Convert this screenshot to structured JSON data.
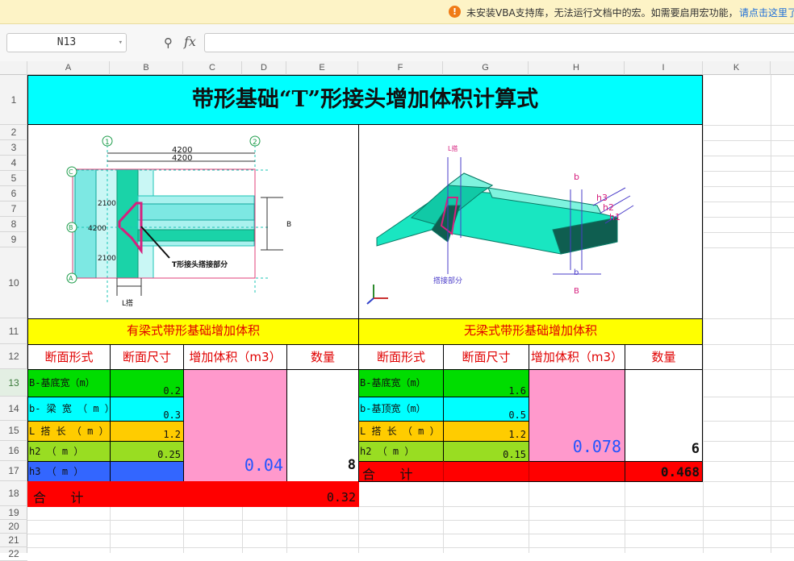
{
  "notice": {
    "message": "未安装VBA支持库，无法运行文档中的宏。如需要启用宏功能，",
    "link": "请点击这里了"
  },
  "formula_bar": {
    "name_box": "N13",
    "fx_label": "fx",
    "formula": ""
  },
  "columns": [
    "A",
    "B",
    "C",
    "D",
    "E",
    "F",
    "G",
    "H",
    "I",
    "K"
  ],
  "rows": [
    "1",
    "2",
    "3",
    "4",
    "5",
    "6",
    "7",
    "8",
    "9",
    "10",
    "11",
    "12",
    "13",
    "14",
    "15",
    "16",
    "17",
    "18",
    "19",
    "20",
    "21",
    "22"
  ],
  "sheet": {
    "title": "带形基础“T”形接头增加体积计算式",
    "left": {
      "heading": "有梁式带形基础增加体积",
      "headers": [
        "断面形式",
        "断面尺寸",
        "增加体积（m3）",
        "数量"
      ],
      "rows": [
        {
          "label": "B-基底宽（m）",
          "value": "0.2"
        },
        {
          "label": "b- 梁 宽 （ m ）",
          "value": "0.3"
        },
        {
          "label": "L 搭 长 （ m ）",
          "value": "1.2"
        },
        {
          "label": "h2  （  m  ）",
          "value": "0.25"
        },
        {
          "label": "h3  （  m  ）",
          "value": ""
        }
      ],
      "volume": "0.04",
      "quantity": "8",
      "total_label": "合      计",
      "total": "0.32"
    },
    "right": {
      "heading": "无梁式带形基础增加体积",
      "headers": [
        "断面形式",
        "断面尺寸",
        "增加体积（m3）",
        "数量"
      ],
      "rows": [
        {
          "label": "B-基底宽（m）",
          "value": "1.6"
        },
        {
          "label": "b-基顶宽（m）",
          "value": "0.5"
        },
        {
          "label": "L 搭 长 （ m ）",
          "value": "1.2"
        },
        {
          "label": "h2  （  m  ）",
          "value": "0.15"
        }
      ],
      "volume": "0.078",
      "quantity": "6",
      "total_label": "合      计",
      "total": "0.468"
    },
    "plan_drawing": {
      "dim_top1": "4200",
      "dim_top2": "4200",
      "dim_left": "4200",
      "dim_2100a": "2100",
      "dim_2100b": "2100",
      "axis_1": "1",
      "axis_2": "2",
      "axis_A": "A",
      "axis_B": "B",
      "axis_C": "C",
      "dim_B": "B",
      "callout": "T形接头搭接部分",
      "dim_L": "L搭"
    },
    "iso_drawing": {
      "label_L": "L搭",
      "label_b": "b",
      "label_h3": "h3",
      "label_h2": "h2",
      "label_h1": "h1",
      "label_overlap": "搭接部分",
      "label_B": "B",
      "label_b2": "b"
    }
  },
  "colors": {
    "title_bg": "#00ffff",
    "heading_bg": "#ffff00",
    "heading_text": "#e00000",
    "volume_bg": "#ff99cc",
    "total_bg": "#ff0000"
  }
}
